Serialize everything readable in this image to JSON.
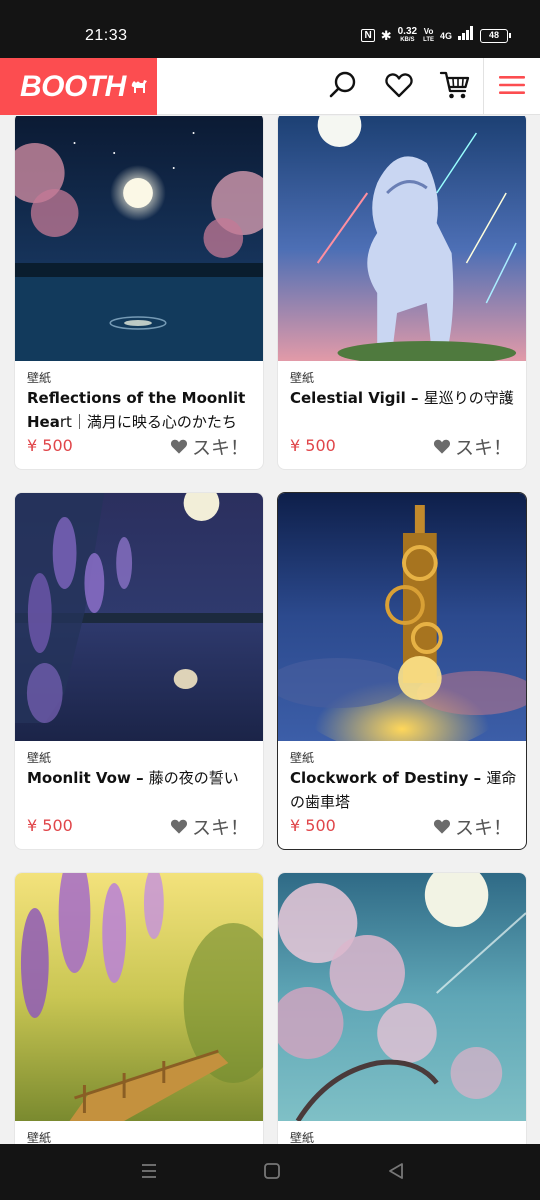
{
  "status_bar": {
    "time": "21:33",
    "net_speed_value": "0.32",
    "net_speed_unit": "KB/S",
    "volte_top": "Vo",
    "volte_bottom": "LTE",
    "network": "4G",
    "battery": "48"
  },
  "header": {
    "logo_text": "BOOTH",
    "icons": [
      "search-icon",
      "heart-icon",
      "cart-icon",
      "menu-icon"
    ],
    "brand_color": "#fc4d50"
  },
  "products": [
    {
      "category": "壁紙",
      "title_en": "Reflections of the Moonlit Hea",
      "title_rest": "rt｜満月に映る心のかたち",
      "price": "¥ 500",
      "like_label": "スキ！"
    },
    {
      "category": "壁紙",
      "title_en": "Celestial Vigil – ",
      "title_rest": "星巡りの守護",
      "price": "¥ 500",
      "like_label": "スキ！"
    },
    {
      "category": "壁紙",
      "title_en": "Moonlit Vow – ",
      "title_rest": "藤の夜の誓い",
      "price": "¥ 500",
      "like_label": "スキ！"
    },
    {
      "category": "壁紙",
      "title_en": "Clockwork of Destiny – ",
      "title_rest": "運命の歯車塔",
      "price": "¥ 500",
      "like_label": "スキ！"
    },
    {
      "category": "壁紙",
      "title_en": "",
      "title_rest": "",
      "price": "",
      "like_label": ""
    },
    {
      "category": "壁紙",
      "title_en": "",
      "title_rest": "",
      "price": "",
      "like_label": ""
    }
  ],
  "nav_bar": {
    "icons": [
      "menu-nav-icon",
      "home-nav-icon",
      "back-nav-icon"
    ]
  }
}
